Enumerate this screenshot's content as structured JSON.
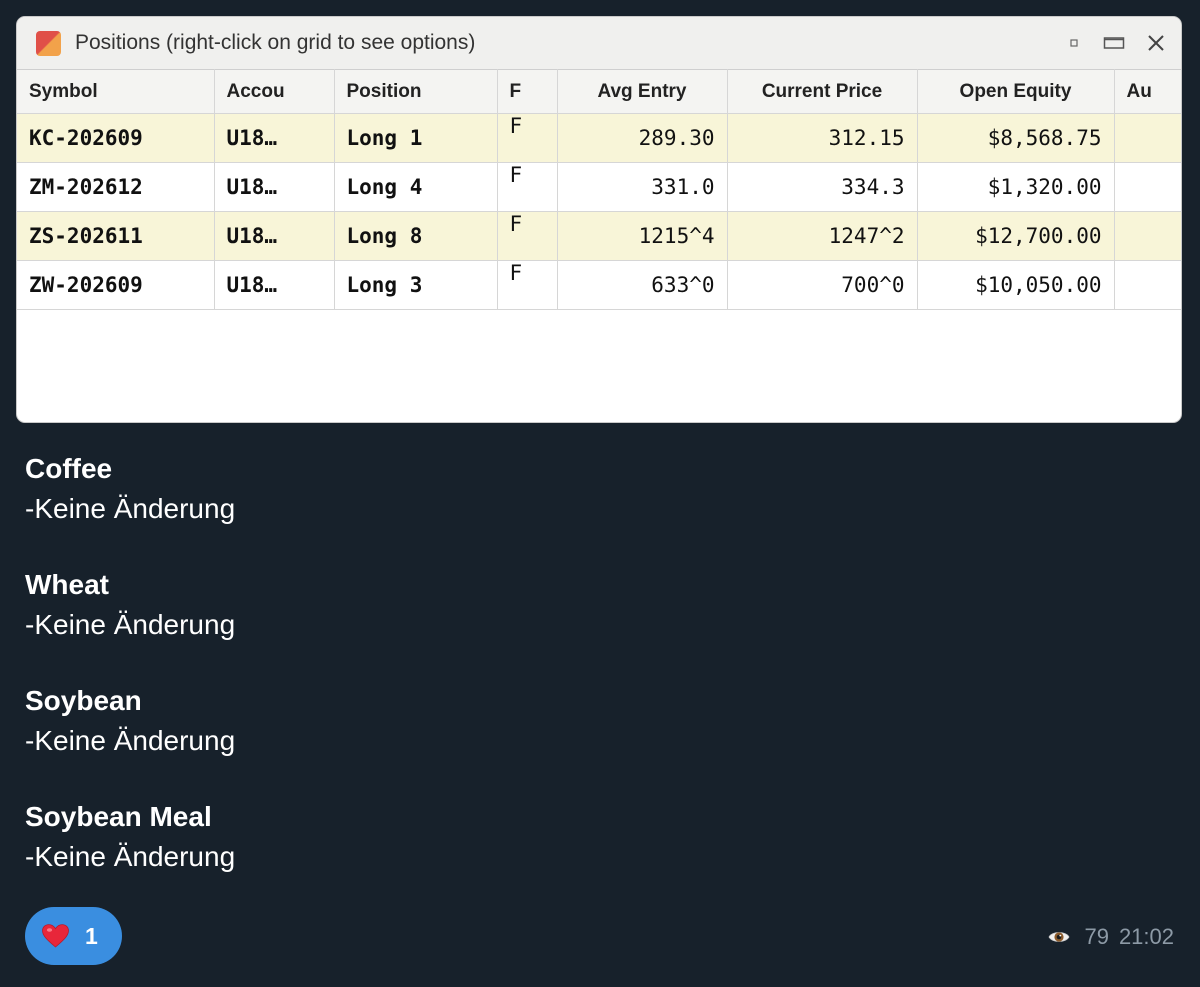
{
  "window": {
    "title": "Positions (right-click on grid to see options)"
  },
  "grid": {
    "columns": [
      "Symbol",
      "Accou",
      "Position",
      "F",
      "Avg Entry",
      "Current Price",
      "Open Equity",
      "Au"
    ],
    "rows": [
      {
        "symbol": "KC-202609",
        "account": "U18…",
        "position": "Long 1",
        "flag": "F",
        "avg_entry": "289.30",
        "current_price": "312.15",
        "open_equity": "$8,568.75",
        "au": ""
      },
      {
        "symbol": "ZM-202612",
        "account": "U18…",
        "position": "Long 4",
        "flag": "F",
        "avg_entry": "331.0",
        "current_price": "334.3",
        "open_equity": "$1,320.00",
        "au": ""
      },
      {
        "symbol": "ZS-202611",
        "account": "U18…",
        "position": "Long 8",
        "flag": "F",
        "avg_entry": "1215^4",
        "current_price": "1247^2",
        "open_equity": "$12,700.00",
        "au": ""
      },
      {
        "symbol": "ZW-202609",
        "account": "U18…",
        "position": "Long 3",
        "flag": "F",
        "avg_entry": "633^0",
        "current_price": "700^0",
        "open_equity": "$10,050.00",
        "au": ""
      }
    ]
  },
  "message": {
    "blocks": [
      {
        "title": "Coffee",
        "text": "-Keine Änderung"
      },
      {
        "title": "Wheat",
        "text": "-Keine Änderung"
      },
      {
        "title": "Soybean",
        "text": "-Keine Änderung"
      },
      {
        "title": "Soybean Meal",
        "text": "-Keine Änderung"
      }
    ]
  },
  "footer": {
    "reaction_emoji": "❤️",
    "reaction_count": "1",
    "views_icon": "eye-icon",
    "views": "79",
    "time": "21:02"
  },
  "colors": {
    "background": "#17212b",
    "row_highlight": "#f8f5d8",
    "green": "#1f9a3a",
    "flag_blue": "#3d35a6",
    "reaction_blue": "#3a8ee0",
    "meta_gray": "#8d9aa6"
  }
}
